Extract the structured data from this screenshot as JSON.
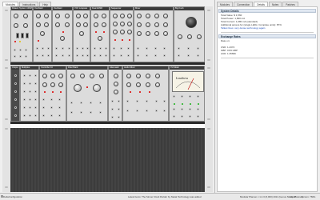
{
  "left_tabs": {
    "items": [
      "Modules",
      "Instructions",
      "Help"
    ],
    "active": 0
  },
  "right_tabs": {
    "items": [
      "Modules",
      "Connection",
      "Details",
      "Notes",
      "Patches"
    ],
    "active": 2
  },
  "details": {
    "system_details_title": "System Details",
    "lines": [
      "Total Value: $ 1,560",
      "Total Power: 1,820 mA",
      "Total Current: 1,080 mA (standard)",
      "Additional access for (single LEDs; Complete units): 87%",
      "Tallest lines: very dense technology again"
    ],
    "exchange_rates_title": "Exchange Rates",
    "exchange_subtitle": "Rate on:",
    "rates": [
      "USD: 1.2374",
      "GBP: 0.84 GBP",
      "AUD: 1.35696"
    ]
  },
  "status": {
    "left": "DeltaConfiguration",
    "news": "Latest items: The Sinner Clock Divider by Nekat Technology was added",
    "title": "Modular Planner v 1.2.3 (6,000) 2011 (Genus Studio Planner)",
    "import": "Import",
    "version_label": "Version: 766G"
  },
  "rack": {
    "modules_row1": [
      {
        "name": "Roland System 100M"
      },
      {
        "name": "Oscillator"
      },
      {
        "name": "Oscillator"
      },
      {
        "name": "VCF Lowpass"
      },
      {
        "name": "Dual ADSR"
      },
      {
        "name": "Sequencer"
      },
      {
        "name": "Mixer"
      },
      {
        "name": "Big Knob"
      }
    ],
    "modules_row2": [
      {
        "name": "Output"
      },
      {
        "name": "Multiples"
      },
      {
        "name": "Controller 16"
      },
      {
        "name": "Filter Bank"
      },
      {
        "name": "Attenuator"
      },
      {
        "name": "Audio Mixer"
      },
      {
        "name": "VU Meter"
      },
      {
        "name": "Switches"
      }
    ],
    "vu_label": "Loudness"
  },
  "colors": {
    "accent_red": "#d11111",
    "accent_yellow": "#e3c21a",
    "rail": "#e3e3e3",
    "panel": "#dcdcdc"
  },
  "icons": {
    "minimize": "minimize-icon"
  }
}
